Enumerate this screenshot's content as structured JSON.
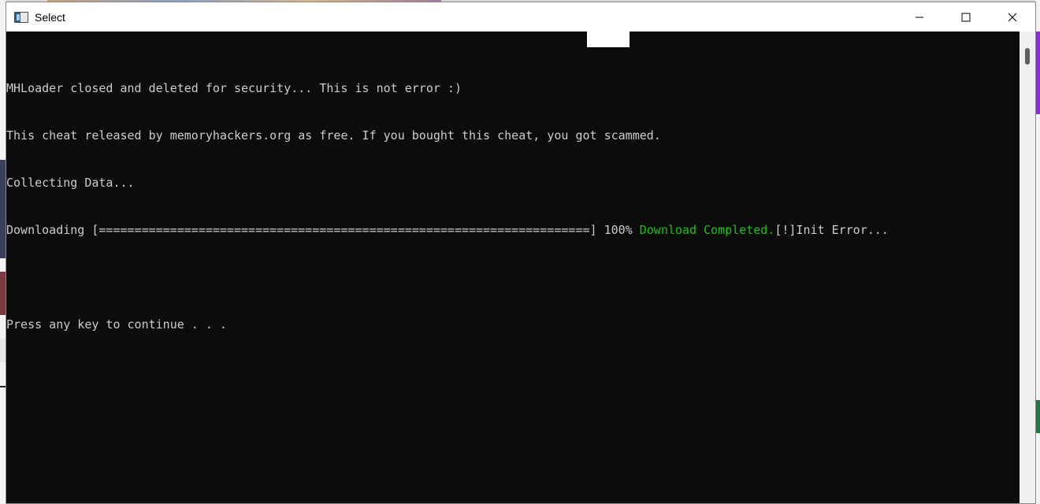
{
  "window": {
    "title": "Select"
  },
  "console": {
    "lines": [
      "MHLoader closed and deleted for security... This is not error :)",
      "This cheat released by memoryhackers.org as free. If you bought this cheat, you got scammed.",
      "Collecting Data..."
    ],
    "download_prefix": "Downloading [=====================================================================] 100% ",
    "download_completed": "Download Completed.",
    "download_suffix": "[!]Init Error...",
    "prompt": "Press any key to continue . . ."
  },
  "colors": {
    "console_bg": "#0c0c0c",
    "console_text": "#cccccc",
    "success_green": "#16c60c"
  },
  "icons": {
    "app": "console-app-icon",
    "minimize": "minimize-icon",
    "maximize": "maximize-icon",
    "close": "close-icon"
  }
}
